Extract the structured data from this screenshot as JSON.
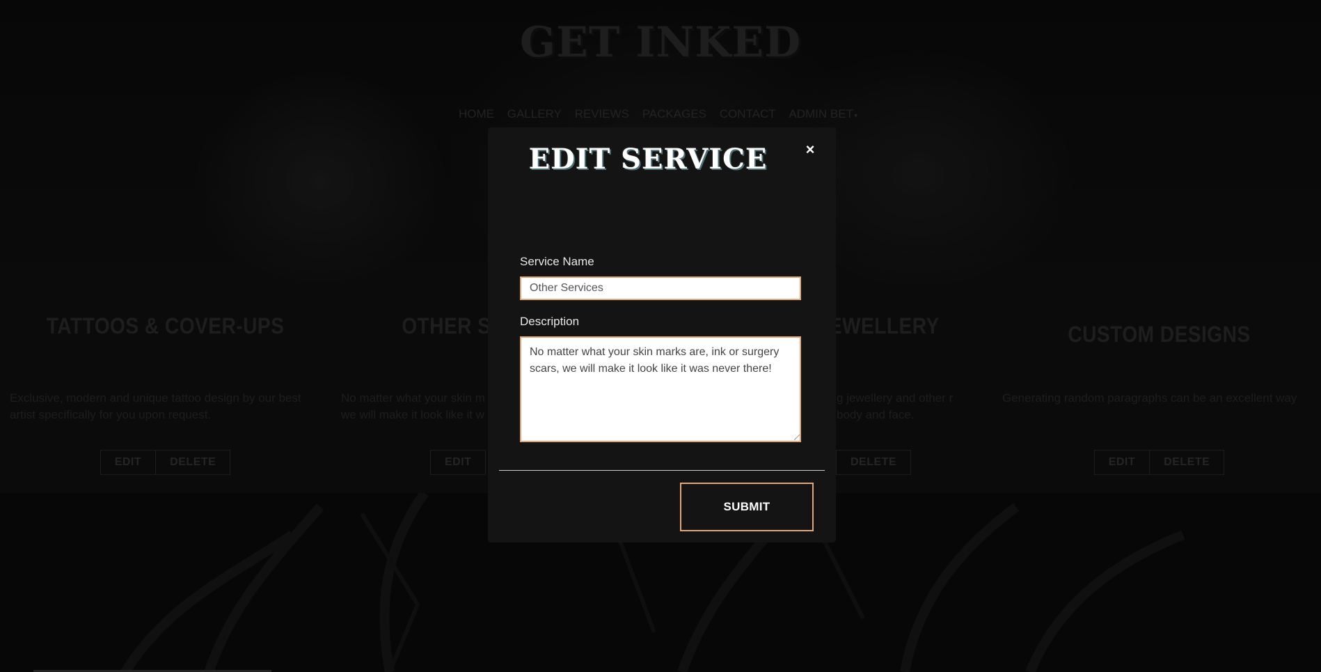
{
  "brand": {
    "title": "GET INKED"
  },
  "nav": {
    "items": [
      "HOME",
      "GALLERY",
      "REVIEWS",
      "PACKAGES",
      "CONTACT",
      "ADMIN BET"
    ],
    "dropdown_caret": "▾"
  },
  "services": [
    {
      "title": "TATTOOS & COVER-UPS",
      "description": "Exclusive, modern and unique tattoo design by our best artist specifically for you upon request.",
      "edit_label": "EDIT",
      "delete_label": "DELETE"
    },
    {
      "title": "OTHER S",
      "description": "No matter what your skin m we will make it look like it w",
      "edit_label": "EDIT",
      "delete_label": ""
    },
    {
      "title": "JEWELLERY",
      "description": "g jewellery and other r body and face.",
      "edit_label": "",
      "delete_label": "DELETE"
    },
    {
      "title": "CUSTOM DESIGNS",
      "description": "Generating random paragraphs can be an excellent way",
      "edit_label": "EDIT",
      "delete_label": "DELETE"
    }
  ],
  "modal": {
    "title": "EDIT SERVICE",
    "close_glyph": "×",
    "service_name_label": "Service Name",
    "service_name_value": "Other Services",
    "description_label": "Description",
    "description_value": "No matter what your skin marks are, ink or surgery scars, we will make it look like it was never there!",
    "submit_label": "SUBMIT"
  },
  "colors": {
    "accent": "#e8a576",
    "modal_bg": "#141414",
    "page_bg": "#0a0a0a"
  }
}
